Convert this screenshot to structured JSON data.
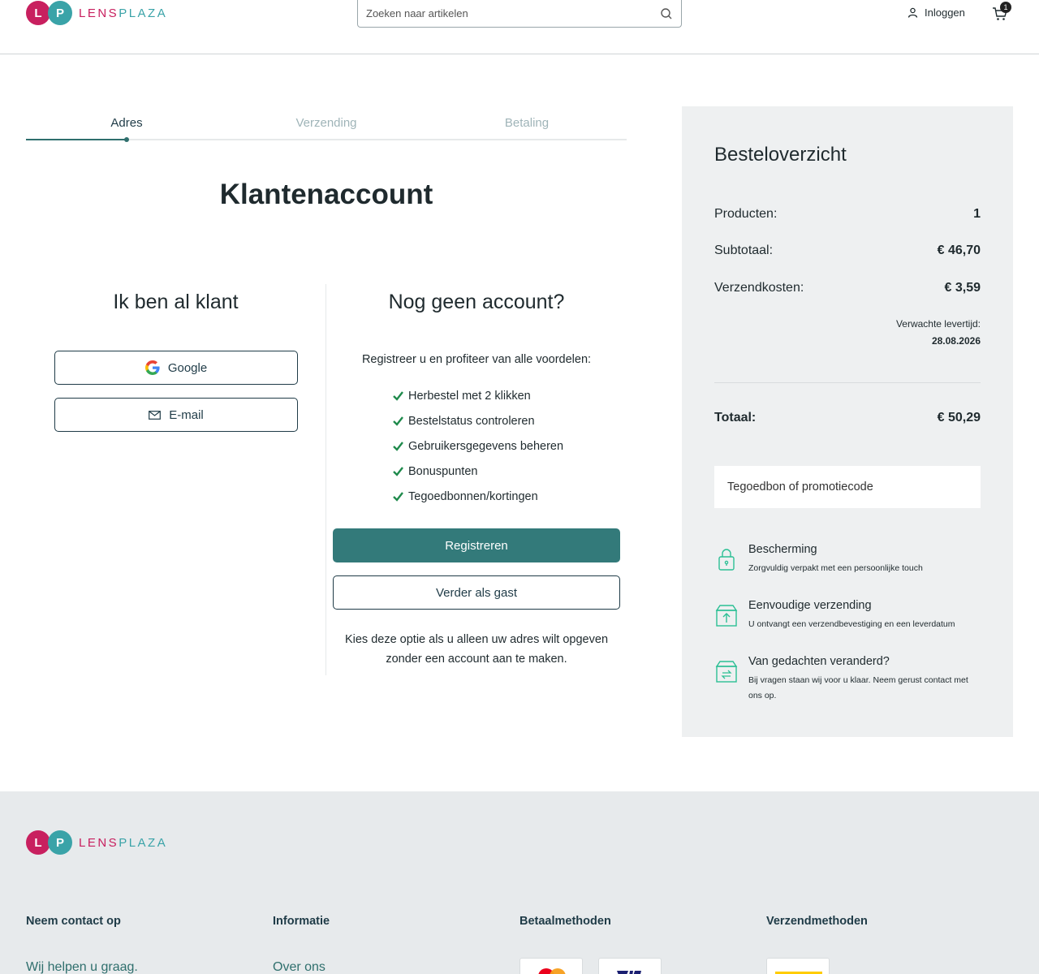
{
  "header": {
    "logo_letters": [
      "L",
      "P"
    ],
    "logo_word_1": "LENS",
    "logo_word_2": "PLAZA",
    "search_placeholder": "Zoeken naar artikelen",
    "login_label": "Inloggen",
    "cart_count": "1"
  },
  "steps": [
    {
      "label": "Adres",
      "active": true
    },
    {
      "label": "Verzending",
      "active": false
    },
    {
      "label": "Betaling",
      "active": false
    }
  ],
  "page_title": "Klantenaccount",
  "existing": {
    "title": "Ik ben al klant",
    "google_label": "Google",
    "email_label": "E-mail"
  },
  "register": {
    "title": "Nog geen account?",
    "intro": "Registreer u en profiteer van alle voordelen:",
    "benefits": [
      "Herbestel met 2 klikken",
      "Bestelstatus controleren",
      "Gebruikersgegevens beheren",
      "Bonuspunten",
      "Tegoedbonnen/kortingen"
    ],
    "register_label": "Registreren",
    "guest_label": "Verder als gast",
    "guest_note": "Kies deze optie als u alleen uw adres wilt opgeven zonder een account aan te maken."
  },
  "summary": {
    "title": "Besteloverzicht",
    "products_label": "Producten:",
    "products_value": "1",
    "subtotal_label": "Subtotaal:",
    "subtotal_value": "€ 46,70",
    "shipping_label": "Verzendkosten:",
    "shipping_value": "€ 3,59",
    "delivery_label": "Verwachte levertijd:",
    "delivery_date": "28.08.2026",
    "total_label": "Totaal:",
    "total_value": "€ 50,29",
    "coupon_placeholder": "Tegoedbon of promotiecode",
    "coupon_value": "",
    "features": [
      {
        "icon": "lock-icon",
        "title": "Bescherming",
        "desc": "Zorgvuldig verpakt met een persoonlijke touch"
      },
      {
        "icon": "box-upload-icon",
        "title": "Eenvoudige verzending",
        "desc": "U ontvangt een verzendbevestiging en een leverdatum"
      },
      {
        "icon": "box-return-icon",
        "title": "Van gedachten veranderd?",
        "desc": "Bij vragen staan wij voor u klaar. Neem gerust contact met ons op."
      }
    ]
  },
  "footer": {
    "contact_title": "Neem contact op",
    "contact_text": "Wij helpen u graag.",
    "info_title": "Informatie",
    "info_link": "Over ons",
    "payment_title": "Betaalmethoden",
    "shipping_title": "Verzendmethoden",
    "payment_methods": [
      "mastercard-logo",
      "visa-logo"
    ],
    "shipping_methods": [
      "dhl-logo"
    ]
  },
  "colors": {
    "primary": "#337a7a",
    "brand_pink": "#c8205f",
    "brand_teal": "#3aa3a8",
    "check_green": "#1f8a4c",
    "summary_bg": "#eef0f1"
  }
}
